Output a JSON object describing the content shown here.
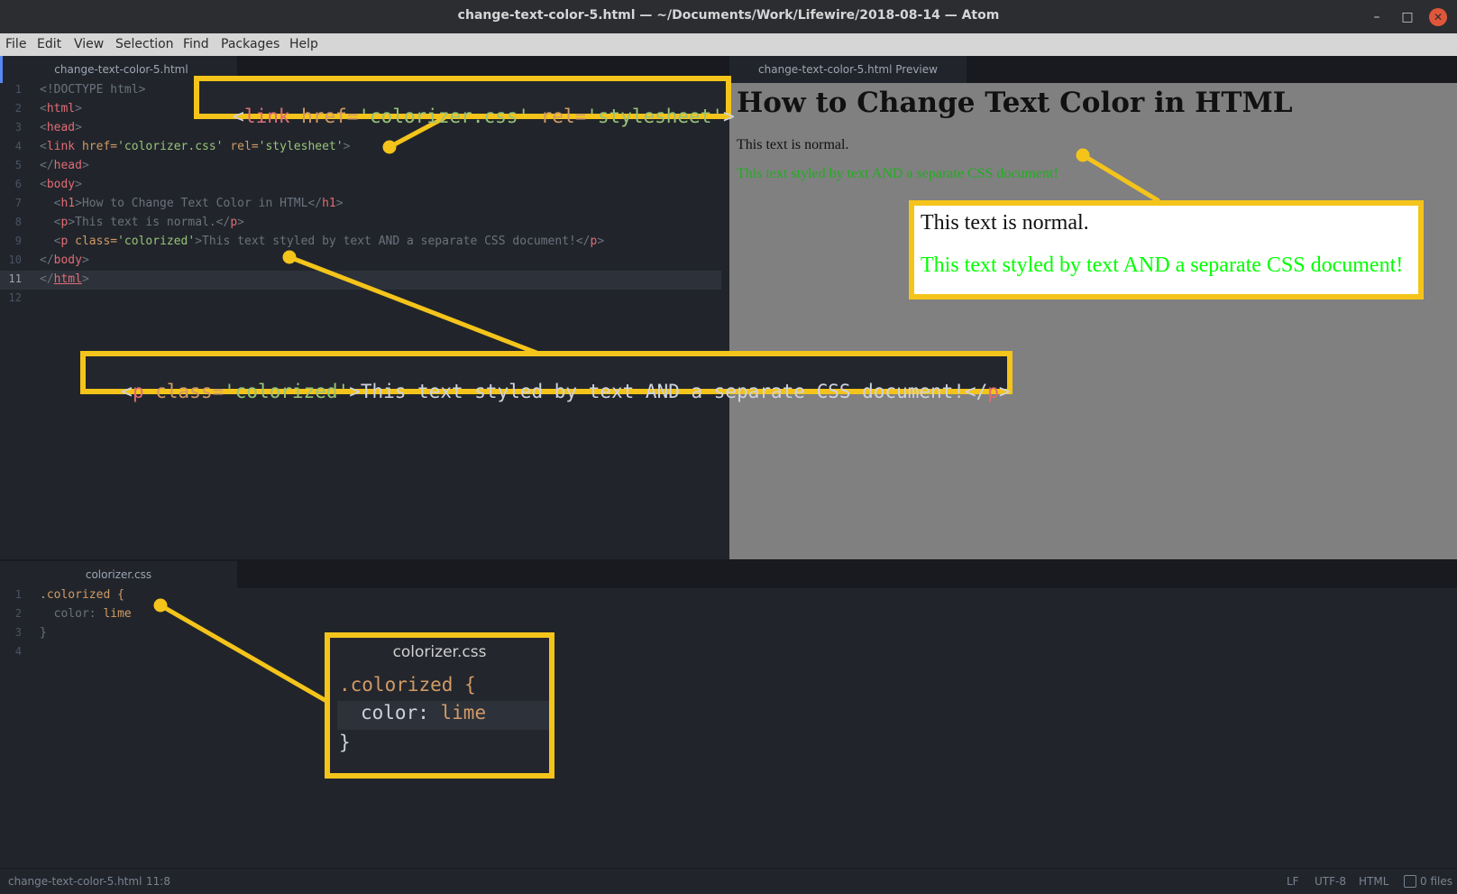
{
  "window": {
    "title": "change-text-color-5.html — ~/Documents/Work/Lifewire/2018-08-14 — Atom",
    "min_glyph": "–",
    "max_glyph": "□",
    "close_glyph": "✕"
  },
  "menu": [
    "File",
    "Edit",
    "View",
    "Selection",
    "Find",
    "Packages",
    "Help"
  ],
  "tabs": {
    "html_tab": "change-text-color-5.html",
    "preview_tab": "change-text-color-5.html Preview",
    "css_tab": "colorizer.css"
  },
  "html_editor": {
    "line_numbers": [
      "1",
      "2",
      "3",
      "4",
      "5",
      "6",
      "7",
      "8",
      "9",
      "10",
      "11",
      "12"
    ],
    "lines": [
      {
        "a": "<!DOCTYPE html>"
      },
      {
        "a": "<",
        "t": "html",
        "b": ">"
      },
      {
        "a": "<",
        "t": "head",
        "b": ">"
      },
      {
        "a": "<",
        "t": "link",
        "b": " href=",
        "s1": "'colorizer.css'",
        "c": " rel=",
        "s2": "'stylesheet'",
        "d": ">"
      },
      {
        "a": "</",
        "t": "head",
        "b": ">"
      },
      {
        "a": "<",
        "t": "body",
        "b": ">"
      },
      {
        "a": "  <",
        "t": "h1",
        "b": ">How to Change Text Color in HTML</",
        "t2": "h1",
        "d": ">"
      },
      {
        "a": "  <",
        "t": "p",
        "b": ">This text is normal.</",
        "t2": "p",
        "d": ">"
      },
      {
        "a": "  <",
        "t": "p",
        "b": " class=",
        "s1": "'colorized'",
        "c": ">This text styled by text AND a separate CSS document!</",
        "t2": "p",
        "d": ">"
      },
      {
        "a": "</",
        "t": "body",
        "b": ">"
      },
      {
        "a": "</",
        "t": "html",
        "b": ">"
      },
      {
        "a": ""
      }
    ]
  },
  "css_editor": {
    "line_numbers": [
      "1",
      "2",
      "3",
      "4"
    ],
    "selector": ".colorized {",
    "property": "  color: ",
    "value": "lime",
    "close": "}"
  },
  "preview": {
    "heading": "How to Change Text Color in HTML",
    "normal_text": "This text is normal.",
    "colored_text": "This text styled by text AND a separate CSS document!"
  },
  "callouts": {
    "link_code": {
      "lt": "<",
      "tag": "link",
      "attr1": " href=",
      "val1": "'colorizer.css'",
      "attr2": " rel=",
      "val2": "'stylesheet'",
      "gt": ">"
    },
    "p_code": {
      "lt": "<",
      "tag": "p",
      "attr": " class=",
      "val": "'colorized'",
      "text": ">This text styled by text AND a separate CSS document!</",
      "tag2": "p",
      "gt": ">"
    },
    "css_title": "colorizer.css",
    "css_selector": ".colorized {",
    "css_property": "color: ",
    "css_value": "lime",
    "css_close": "}",
    "preview_normal": "This text is normal.",
    "preview_colored": "This text styled by text AND a separate CSS document!"
  },
  "status": {
    "file": "change-text-color-5.html",
    "position": "11:8",
    "line_ending": "LF",
    "encoding": "UTF-8",
    "grammar": "HTML",
    "files": "0 files"
  },
  "colors": {
    "accent": "#f4c41b",
    "lime": "#00ff00",
    "preview_green": "#1fae1f",
    "tag_red": "#e06c75",
    "string_green": "#98c379",
    "orange": "#d19a66"
  }
}
